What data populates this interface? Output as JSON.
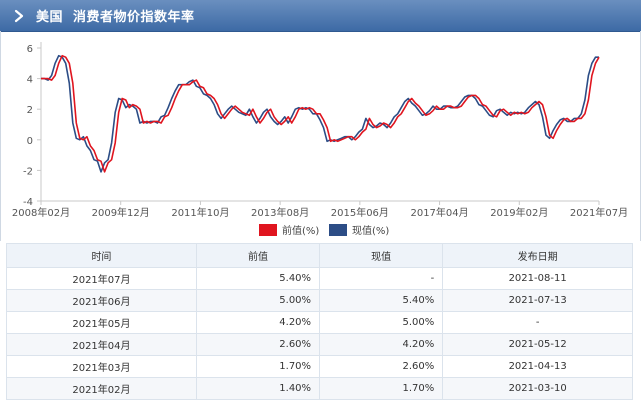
{
  "header": {
    "title": "美国  消费者物价指数年率"
  },
  "chart_data": {
    "type": "line",
    "ylim": [
      -4,
      6
    ],
    "yticks": [
      -4,
      -2,
      0,
      2,
      4,
      6
    ],
    "x_tick_labels": [
      "2008年02月",
      "2009年12月",
      "2011年10月",
      "2013年08月",
      "2015年06月",
      "2017年04月",
      "2019年02月",
      "2021年07月"
    ],
    "x_start": "2008年02月",
    "x_end": "2021年07月",
    "series": [
      {
        "name": "前值(%)",
        "color": "#e0151f",
        "values": [
          [
            0,
            4.0
          ],
          [
            1,
            4.0
          ],
          [
            2,
            4.0
          ],
          [
            3,
            3.9
          ],
          [
            4,
            4.2
          ],
          [
            5,
            5.0
          ],
          [
            6,
            5.5
          ],
          [
            7,
            5.4
          ],
          [
            8,
            5.0
          ],
          [
            9,
            3.7
          ],
          [
            10,
            1.1
          ],
          [
            11,
            0.1
          ],
          [
            12,
            0.0
          ],
          [
            13,
            0.2
          ],
          [
            14,
            -0.4
          ],
          [
            15,
            -0.7
          ],
          [
            16,
            -1.3
          ],
          [
            17,
            -1.4
          ],
          [
            18,
            -2.1
          ],
          [
            19,
            -1.5
          ],
          [
            20,
            -1.3
          ],
          [
            21,
            -0.2
          ],
          [
            22,
            1.8
          ],
          [
            23,
            2.7
          ],
          [
            24,
            2.6
          ],
          [
            25,
            2.1
          ],
          [
            26,
            2.3
          ],
          [
            27,
            2.2
          ],
          [
            28,
            2.0
          ],
          [
            29,
            1.1
          ],
          [
            30,
            1.2
          ],
          [
            31,
            1.1
          ],
          [
            32,
            1.2
          ],
          [
            33,
            1.2
          ],
          [
            34,
            1.1
          ],
          [
            35,
            1.5
          ],
          [
            36,
            1.6
          ],
          [
            37,
            2.1
          ],
          [
            38,
            2.7
          ],
          [
            39,
            3.2
          ],
          [
            40,
            3.6
          ],
          [
            41,
            3.6
          ],
          [
            42,
            3.6
          ],
          [
            43,
            3.8
          ],
          [
            44,
            3.9
          ],
          [
            45,
            3.5
          ],
          [
            46,
            3.4
          ],
          [
            47,
            3.0
          ],
          [
            48,
            2.9
          ],
          [
            49,
            2.7
          ],
          [
            50,
            2.3
          ],
          [
            51,
            1.7
          ],
          [
            52,
            1.4
          ],
          [
            53,
            1.7
          ],
          [
            54,
            2.0
          ],
          [
            55,
            2.2
          ],
          [
            56,
            2.0
          ],
          [
            57,
            1.8
          ],
          [
            58,
            1.7
          ],
          [
            59,
            1.6
          ],
          [
            60,
            2.0
          ],
          [
            61,
            1.5
          ],
          [
            62,
            1.1
          ],
          [
            63,
            1.4
          ],
          [
            64,
            1.8
          ],
          [
            65,
            2.0
          ],
          [
            66,
            1.5
          ],
          [
            67,
            1.2
          ],
          [
            68,
            1.0
          ],
          [
            69,
            1.2
          ],
          [
            70,
            1.5
          ],
          [
            71,
            1.1
          ],
          [
            72,
            1.5
          ],
          [
            73,
            2.0
          ],
          [
            74,
            2.1
          ],
          [
            75,
            2.0
          ],
          [
            76,
            2.1
          ],
          [
            77,
            2.0
          ],
          [
            78,
            1.7
          ],
          [
            79,
            1.7
          ],
          [
            80,
            1.3
          ],
          [
            81,
            0.8
          ],
          [
            82,
            -0.1
          ],
          [
            83,
            0.0
          ],
          [
            84,
            -0.1
          ],
          [
            85,
            0.0
          ],
          [
            86,
            0.1
          ],
          [
            87,
            0.2
          ],
          [
            88,
            0.2
          ],
          [
            89,
            0.0
          ],
          [
            90,
            0.2
          ],
          [
            91,
            0.5
          ],
          [
            92,
            0.7
          ],
          [
            93,
            1.4
          ],
          [
            94,
            1.0
          ],
          [
            95,
            0.8
          ],
          [
            96,
            0.9
          ],
          [
            97,
            1.1
          ],
          [
            98,
            1.0
          ],
          [
            99,
            0.8
          ],
          [
            100,
            1.1
          ],
          [
            101,
            1.5
          ],
          [
            102,
            1.7
          ],
          [
            103,
            2.1
          ],
          [
            104,
            2.5
          ],
          [
            105,
            2.7
          ],
          [
            106,
            2.4
          ],
          [
            107,
            2.2
          ],
          [
            108,
            1.9
          ],
          [
            109,
            1.6
          ],
          [
            110,
            1.7
          ],
          [
            111,
            1.9
          ],
          [
            112,
            2.2
          ],
          [
            113,
            2.0
          ],
          [
            114,
            2.0
          ],
          [
            115,
            2.2
          ],
          [
            116,
            2.2
          ],
          [
            117,
            2.1
          ],
          [
            118,
            2.1
          ],
          [
            119,
            2.2
          ],
          [
            120,
            2.5
          ],
          [
            121,
            2.8
          ],
          [
            122,
            2.9
          ],
          [
            123,
            2.9
          ],
          [
            124,
            2.7
          ],
          [
            125,
            2.3
          ],
          [
            126,
            2.2
          ],
          [
            127,
            1.9
          ],
          [
            128,
            1.6
          ],
          [
            129,
            1.5
          ],
          [
            130,
            1.9
          ],
          [
            131,
            2.0
          ],
          [
            132,
            1.8
          ],
          [
            133,
            1.6
          ],
          [
            134,
            1.8
          ],
          [
            135,
            1.7
          ],
          [
            136,
            1.8
          ],
          [
            137,
            1.7
          ],
          [
            138,
            1.8
          ],
          [
            139,
            2.1
          ],
          [
            140,
            2.3
          ],
          [
            141,
            2.5
          ],
          [
            142,
            2.3
          ],
          [
            143,
            1.5
          ],
          [
            144,
            0.3
          ],
          [
            145,
            0.1
          ],
          [
            146,
            0.6
          ],
          [
            147,
            1.0
          ],
          [
            148,
            1.3
          ],
          [
            149,
            1.4
          ],
          [
            150,
            1.2
          ],
          [
            151,
            1.2
          ],
          [
            152,
            1.4
          ],
          [
            153,
            1.4
          ],
          [
            154,
            1.7
          ],
          [
            155,
            2.6
          ],
          [
            156,
            4.2
          ],
          [
            157,
            5.0
          ],
          [
            158,
            5.4
          ]
        ]
      },
      {
        "name": "现值(%)",
        "color": "#2c4d86",
        "values": [
          [
            0,
            4.0
          ],
          [
            1,
            4.0
          ],
          [
            2,
            3.9
          ],
          [
            3,
            4.2
          ],
          [
            4,
            5.0
          ],
          [
            5,
            5.5
          ],
          [
            6,
            5.4
          ],
          [
            7,
            5.0
          ],
          [
            8,
            3.7
          ],
          [
            9,
            1.1
          ],
          [
            10,
            0.1
          ],
          [
            11,
            0.0
          ],
          [
            12,
            0.2
          ],
          [
            13,
            -0.4
          ],
          [
            14,
            -0.7
          ],
          [
            15,
            -1.3
          ],
          [
            16,
            -1.4
          ],
          [
            17,
            -2.1
          ],
          [
            18,
            -1.5
          ],
          [
            19,
            -1.3
          ],
          [
            20,
            -0.2
          ],
          [
            21,
            1.8
          ],
          [
            22,
            2.7
          ],
          [
            23,
            2.6
          ],
          [
            24,
            2.1
          ],
          [
            25,
            2.3
          ],
          [
            26,
            2.2
          ],
          [
            27,
            2.0
          ],
          [
            28,
            1.1
          ],
          [
            29,
            1.2
          ],
          [
            30,
            1.1
          ],
          [
            31,
            1.2
          ],
          [
            32,
            1.2
          ],
          [
            33,
            1.1
          ],
          [
            34,
            1.5
          ],
          [
            35,
            1.6
          ],
          [
            36,
            2.1
          ],
          [
            37,
            2.7
          ],
          [
            38,
            3.2
          ],
          [
            39,
            3.6
          ],
          [
            40,
            3.6
          ],
          [
            41,
            3.6
          ],
          [
            42,
            3.8
          ],
          [
            43,
            3.9
          ],
          [
            44,
            3.5
          ],
          [
            45,
            3.4
          ],
          [
            46,
            3.0
          ],
          [
            47,
            2.9
          ],
          [
            48,
            2.7
          ],
          [
            49,
            2.3
          ],
          [
            50,
            1.7
          ],
          [
            51,
            1.4
          ],
          [
            52,
            1.7
          ],
          [
            53,
            2.0
          ],
          [
            54,
            2.2
          ],
          [
            55,
            2.0
          ],
          [
            56,
            1.8
          ],
          [
            57,
            1.7
          ],
          [
            58,
            1.6
          ],
          [
            59,
            2.0
          ],
          [
            60,
            1.5
          ],
          [
            61,
            1.1
          ],
          [
            62,
            1.4
          ],
          [
            63,
            1.8
          ],
          [
            64,
            2.0
          ],
          [
            65,
            1.5
          ],
          [
            66,
            1.2
          ],
          [
            67,
            1.0
          ],
          [
            68,
            1.2
          ],
          [
            69,
            1.5
          ],
          [
            70,
            1.1
          ],
          [
            71,
            1.5
          ],
          [
            72,
            2.0
          ],
          [
            73,
            2.1
          ],
          [
            74,
            2.0
          ],
          [
            75,
            2.1
          ],
          [
            76,
            2.0
          ],
          [
            77,
            1.7
          ],
          [
            78,
            1.7
          ],
          [
            79,
            1.3
          ],
          [
            80,
            0.8
          ],
          [
            81,
            -0.1
          ],
          [
            82,
            0.0
          ],
          [
            83,
            -0.1
          ],
          [
            84,
            0.0
          ],
          [
            85,
            0.1
          ],
          [
            86,
            0.2
          ],
          [
            87,
            0.2
          ],
          [
            88,
            0.0
          ],
          [
            89,
            0.2
          ],
          [
            90,
            0.5
          ],
          [
            91,
            0.7
          ],
          [
            92,
            1.4
          ],
          [
            93,
            1.0
          ],
          [
            94,
            0.8
          ],
          [
            95,
            0.9
          ],
          [
            96,
            1.1
          ],
          [
            97,
            1.0
          ],
          [
            98,
            0.8
          ],
          [
            99,
            1.1
          ],
          [
            100,
            1.5
          ],
          [
            101,
            1.7
          ],
          [
            102,
            2.1
          ],
          [
            103,
            2.5
          ],
          [
            104,
            2.7
          ],
          [
            105,
            2.4
          ],
          [
            106,
            2.2
          ],
          [
            107,
            1.9
          ],
          [
            108,
            1.6
          ],
          [
            109,
            1.7
          ],
          [
            110,
            1.9
          ],
          [
            111,
            2.2
          ],
          [
            112,
            2.0
          ],
          [
            113,
            2.0
          ],
          [
            114,
            2.2
          ],
          [
            115,
            2.2
          ],
          [
            116,
            2.1
          ],
          [
            117,
            2.1
          ],
          [
            118,
            2.2
          ],
          [
            119,
            2.5
          ],
          [
            120,
            2.8
          ],
          [
            121,
            2.9
          ],
          [
            122,
            2.9
          ],
          [
            123,
            2.7
          ],
          [
            124,
            2.3
          ],
          [
            125,
            2.2
          ],
          [
            126,
            1.9
          ],
          [
            127,
            1.6
          ],
          [
            128,
            1.5
          ],
          [
            129,
            1.9
          ],
          [
            130,
            2.0
          ],
          [
            131,
            1.8
          ],
          [
            132,
            1.6
          ],
          [
            133,
            1.8
          ],
          [
            134,
            1.7
          ],
          [
            135,
            1.8
          ],
          [
            136,
            1.7
          ],
          [
            137,
            1.8
          ],
          [
            138,
            2.1
          ],
          [
            139,
            2.3
          ],
          [
            140,
            2.5
          ],
          [
            141,
            2.3
          ],
          [
            142,
            1.5
          ],
          [
            143,
            0.3
          ],
          [
            144,
            0.1
          ],
          [
            145,
            0.6
          ],
          [
            146,
            1.0
          ],
          [
            147,
            1.3
          ],
          [
            148,
            1.4
          ],
          [
            149,
            1.2
          ],
          [
            150,
            1.2
          ],
          [
            151,
            1.4
          ],
          [
            152,
            1.4
          ],
          [
            153,
            1.7
          ],
          [
            154,
            2.6
          ],
          [
            155,
            4.2
          ],
          [
            156,
            5.0
          ],
          [
            157,
            5.4
          ],
          [
            158,
            5.4
          ]
        ]
      }
    ],
    "legend": [
      "前值(%)",
      "现值(%)"
    ],
    "legend_position": "bottom-center",
    "grid": false
  },
  "table": {
    "headers": [
      "时间",
      "前值",
      "现值",
      "发布日期"
    ],
    "rows": [
      [
        "2021年07月",
        "5.40%",
        "-",
        "2021-08-11"
      ],
      [
        "2021年06月",
        "5.00%",
        "5.40%",
        "2021-07-13"
      ],
      [
        "2021年05月",
        "4.20%",
        "5.00%",
        "-"
      ],
      [
        "2021年04月",
        "2.60%",
        "4.20%",
        "2021-05-12"
      ],
      [
        "2021年03月",
        "1.70%",
        "2.60%",
        "2021-04-13"
      ],
      [
        "2021年02月",
        "1.40%",
        "1.70%",
        "2021-03-10"
      ]
    ]
  }
}
